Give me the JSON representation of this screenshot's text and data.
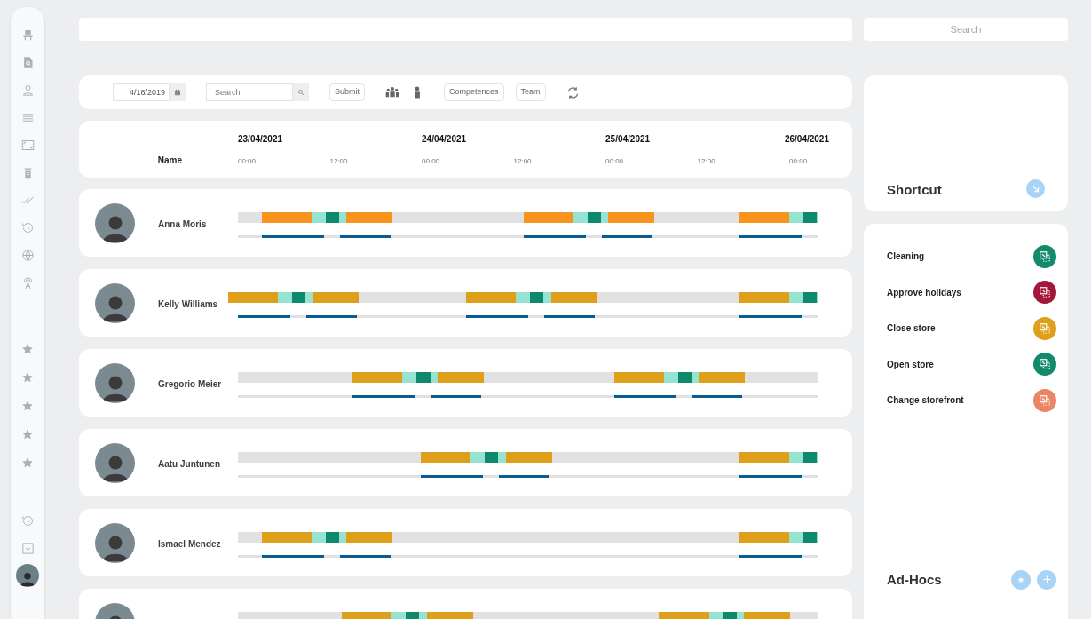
{
  "top_search": {
    "placeholder": "Search"
  },
  "toolbar": {
    "date": "4/18/2019",
    "search": {
      "placeholder": "Search"
    },
    "submit": "Submit",
    "competences": "Competences",
    "team": "Team"
  },
  "timeline": {
    "name_header": "Name",
    "days": [
      {
        "date": "23/04/2021",
        "ticks": [
          "00:00",
          "12:00"
        ]
      },
      {
        "date": "24/04/2021",
        "ticks": [
          "00:00",
          "12:00"
        ]
      },
      {
        "date": "25/04/2021",
        "ticks": [
          "00:00",
          "12:00"
        ]
      },
      {
        "date": "26/04/2021",
        "ticks": [
          "00:00"
        ]
      }
    ]
  },
  "rows": [
    {
      "name": "Anna Moris",
      "color": "#f7941d"
    },
    {
      "name": "Kelly Williams",
      "color": "#dea01a"
    },
    {
      "name": "Gregorio Meier",
      "color": "#dea01a"
    },
    {
      "name": "Aatu Juntunen",
      "color": "#dea01a"
    },
    {
      "name": "Ismael Mendez",
      "color": "#dea01a"
    },
    {
      "color": "#dea01a"
    }
  ],
  "shortcut": {
    "title": "Shortcut"
  },
  "actions": [
    {
      "label": "Cleaning",
      "color": "#138a6c"
    },
    {
      "label": "Approve holidays",
      "color": "#a3183a"
    },
    {
      "label": "Close store",
      "color": "#dea01a"
    },
    {
      "label": "Open store",
      "color": "#138a6c"
    },
    {
      "label": "Change storefront",
      "color": "#ec8466"
    }
  ],
  "adhocs": {
    "title": "Ad-Hocs"
  }
}
